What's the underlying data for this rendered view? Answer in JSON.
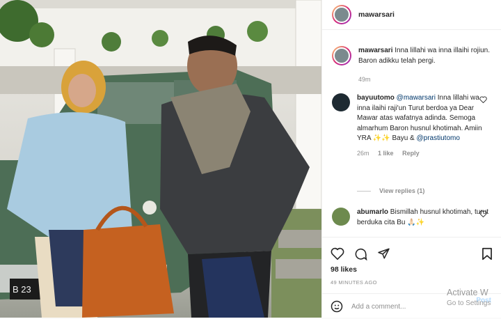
{
  "post": {
    "username": "mawarsari",
    "caption_user": "mawarsari",
    "caption_text": "Inna lillahi wa inna illaihi rojiun. Baron adikku telah pergi.",
    "caption_time": "49m",
    "photo_plate": "B 23"
  },
  "comments": [
    {
      "user": "bayuutomo",
      "mention": "@mawarsari",
      "text": "Inna lillahi wa inna ilaihi raji'un Turut berdoa ya Dear Mawar atas wafatnya adinda. Semoga almarhum Baron husnul khotimah. Amiin YRA ✨✨ Bayu &",
      "mention2": "@prastiutomo",
      "time": "26m",
      "likes": "1 like",
      "reply": "Reply",
      "view_replies": "View replies (1)"
    },
    {
      "user": "abumarlo",
      "text": "Bismillah husnul khotimah, turut berduka cita Bu 🙏🏻✨"
    }
  ],
  "footer": {
    "likes": "98 likes",
    "time_ago": "49 MINUTES AGO",
    "add_comment_placeholder": "Add a comment...",
    "post_label": "Post"
  },
  "watermark": {
    "line1": "Activate W",
    "line2": "Go to Settings"
  },
  "icons": [
    "heart-icon",
    "comment-icon",
    "share-icon",
    "bookmark-icon",
    "emoji-icon"
  ],
  "colors": {
    "mention": "#00376b",
    "post_button": "#b3dbff",
    "muted": "#8e8e8e"
  }
}
